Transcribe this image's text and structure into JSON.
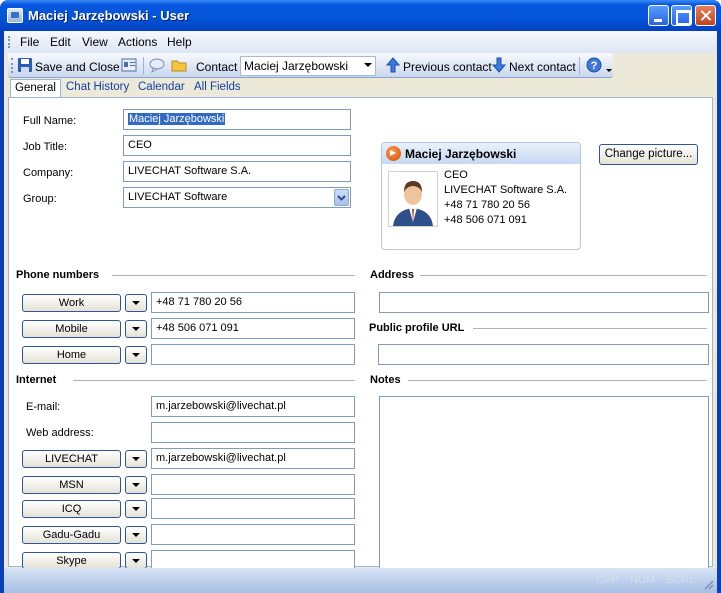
{
  "window": {
    "title": "Maciej Jarzębowski - User"
  },
  "menu": [
    "File",
    "Edit",
    "View",
    "Actions",
    "Help"
  ],
  "toolbar": {
    "save_close": "Save and Close",
    "contact_label": "Contact",
    "contact_value": "Maciej Jarzębowski",
    "prev": "Previous contact",
    "next": "Next contact"
  },
  "tabs": [
    "General",
    "Chat History",
    "Calendar",
    "All Fields"
  ],
  "general": {
    "full_name_label": "Full Name:",
    "full_name": "Maciej Jarzębowski",
    "job_title_label": "Job Title:",
    "job_title": "CEO",
    "company_label": "Company:",
    "company": "LIVECHAT Software S.A.",
    "group_label": "Group:",
    "group": "LIVECHAT Software"
  },
  "card": {
    "name": "Maciej Jarzębowski",
    "lines": [
      "CEO",
      "LIVECHAT Software S.A.",
      "+48 71 780 20 56",
      "+48 506 071 091"
    ]
  },
  "change_picture": "Change picture...",
  "phone": {
    "title": "Phone numbers",
    "rows": [
      {
        "label": "Work",
        "value": "+48 71 780 20 56"
      },
      {
        "label": "Mobile",
        "value": "+48 506 071 091"
      },
      {
        "label": "Home",
        "value": ""
      }
    ]
  },
  "internet": {
    "title": "Internet",
    "email_label": "E-mail:",
    "email": "m.jarzebowski@livechat.pl",
    "web_label": "Web address:",
    "web": "",
    "im": [
      {
        "label": "LIVECHAT",
        "value": "m.jarzebowski@livechat.pl"
      },
      {
        "label": "MSN",
        "value": ""
      },
      {
        "label": "ICQ",
        "value": ""
      },
      {
        "label": "Gadu-Gadu",
        "value": ""
      },
      {
        "label": "Skype",
        "value": ""
      }
    ]
  },
  "address": {
    "title": "Address",
    "value": ""
  },
  "public_url": {
    "title": "Public profile URL",
    "value": ""
  },
  "notes": {
    "title": "Notes",
    "value": ""
  },
  "status": {
    "caps": "CAP",
    "num": "NUM",
    "scrl": "SCRL"
  },
  "colors": {
    "titlebar": "#0454d8",
    "selection": "#316ac5",
    "panel": "#ece9d8"
  }
}
